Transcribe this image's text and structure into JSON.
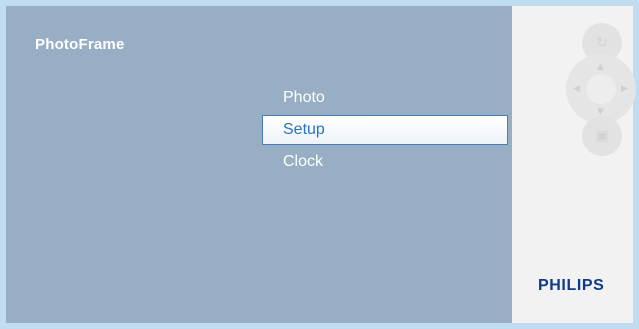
{
  "app": {
    "title": "PhotoFrame"
  },
  "menu": {
    "items": [
      {
        "label": "Photo",
        "selected": false
      },
      {
        "label": "Setup",
        "selected": true
      },
      {
        "label": "Clock",
        "selected": false
      }
    ]
  },
  "side_panel": {
    "brand": "PHILIPS",
    "controls": [
      "slideshow-icon",
      "navigation-pad-icon",
      "menu-icon"
    ]
  },
  "colors": {
    "screen_bg": "#97aec4",
    "frame_bg": "#bfdcf0",
    "selected_text": "#2a72c4",
    "brand": "#0d3a8a"
  }
}
